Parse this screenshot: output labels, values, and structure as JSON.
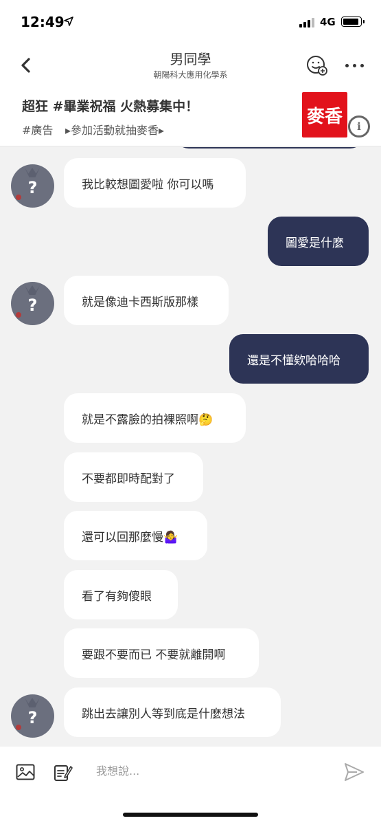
{
  "status": {
    "time": "12:49",
    "network": "4G",
    "icons": [
      "location-arrow-icon",
      "signal-icon",
      "battery-icon"
    ]
  },
  "header": {
    "title": "男同學",
    "subtitle": "朝陽科大應用化學系",
    "icons": [
      "back-chevron-icon",
      "emoji-add-icon",
      "more-dots-icon"
    ]
  },
  "ad": {
    "title": "超狂 #畢業祝福 火熱募集中！",
    "tag": "#廣告",
    "link": "▸參加活動就抽麥香▸",
    "logo_text": "麥香",
    "logo_color": "#e2121b"
  },
  "messages": [
    {
      "side": "in",
      "text": "我比較想圖愛啦 你可以嗎",
      "avatar": true
    },
    {
      "side": "out",
      "text": "圖愛是什麼"
    },
    {
      "side": "in",
      "text": "就是像迪卡西斯版那樣",
      "avatar": true
    },
    {
      "side": "out",
      "text": "還是不懂欸哈哈哈"
    },
    {
      "side": "in",
      "text": "就是不露臉的拍裸照啊🤔",
      "avatar": false
    },
    {
      "side": "in",
      "text": "不要都即時配對了",
      "avatar": false
    },
    {
      "side": "in",
      "text": "還可以回那麼慢🤷‍♀️",
      "avatar": false
    },
    {
      "side": "in",
      "text": "看了有夠傻眼",
      "avatar": false
    },
    {
      "side": "in",
      "text": "要跟不要而已 不要就離開啊",
      "avatar": false
    },
    {
      "side": "in",
      "text": "跳出去讓別人等到底是什麼想法",
      "avatar": true
    }
  ],
  "avatar": {
    "symbol": "?"
  },
  "composer": {
    "placeholder": "我想說...",
    "icons": [
      "image-icon",
      "note-icon",
      "send-icon"
    ]
  },
  "colors": {
    "outgoing_bubble": "#2d3456",
    "incoming_bubble": "#ffffff",
    "chat_background": "#f2f2f2"
  }
}
